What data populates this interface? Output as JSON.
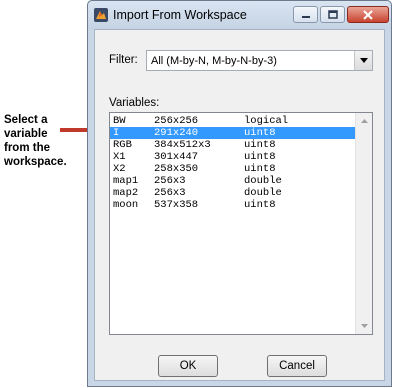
{
  "annotation": {
    "lines": [
      "Select a",
      "variable",
      "from the",
      "workspace."
    ],
    "arrow_color": "#c0392b"
  },
  "window": {
    "title": "Import From Workspace",
    "app_icon": "matlab-icon",
    "controls": [
      "minimize-icon",
      "maximize-icon",
      "close-icon"
    ]
  },
  "filter": {
    "label": "Filter:",
    "selected": "All (M-by-N, M-by-N-by-3)"
  },
  "variables": {
    "label": "Variables:",
    "selected_index": 1,
    "rows": [
      {
        "name": "BW",
        "size": "256x256",
        "class": "logical"
      },
      {
        "name": "I",
        "size": "291x240",
        "class": "uint8"
      },
      {
        "name": "RGB",
        "size": "384x512x3",
        "class": "uint8"
      },
      {
        "name": "X1",
        "size": "301x447",
        "class": "uint8"
      },
      {
        "name": "X2",
        "size": "258x350",
        "class": "uint8"
      },
      {
        "name": "map1",
        "size": "256x3",
        "class": "double"
      },
      {
        "name": "map2",
        "size": "256x3",
        "class": "double"
      },
      {
        "name": "moon",
        "size": "537x358",
        "class": "uint8"
      }
    ]
  },
  "buttons": {
    "ok": "OK",
    "cancel": "Cancel"
  },
  "colors": {
    "selection": "#3399ff",
    "close_button": "#c9432f"
  }
}
